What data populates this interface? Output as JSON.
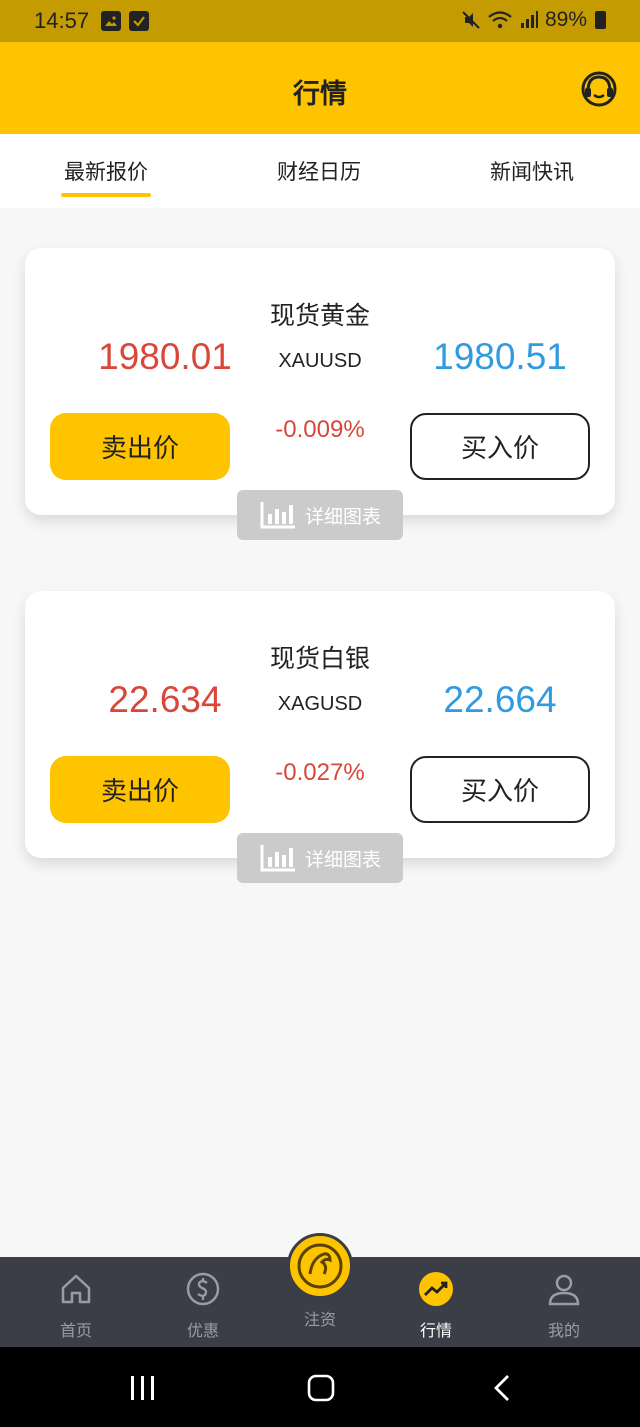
{
  "status_bar": {
    "time": "14:57",
    "battery": "89%"
  },
  "app_bar": {
    "title": "行情"
  },
  "tabs": [
    {
      "label": "最新报价",
      "active": true
    },
    {
      "label": "财经日历",
      "active": false
    },
    {
      "label": "新闻快讯",
      "active": false
    }
  ],
  "quotes": [
    {
      "name": "现货黄金",
      "symbol": "XAUUSD",
      "bid": "1980.01",
      "ask": "1980.51",
      "change": "-0.009%",
      "sell_label": "卖出价",
      "buy_label": "买入价",
      "chart_label": "详细图表"
    },
    {
      "name": "现货白银",
      "symbol": "XAGUSD",
      "bid": "22.634",
      "ask": "22.664",
      "change": "-0.027%",
      "sell_label": "卖出价",
      "buy_label": "买入价",
      "chart_label": "详细图表"
    }
  ],
  "bottom_nav": [
    {
      "label": "首页",
      "icon": "home-icon"
    },
    {
      "label": "优惠",
      "icon": "dollar-icon"
    },
    {
      "label": "注资",
      "icon": "deposit-logo-icon"
    },
    {
      "label": "行情",
      "icon": "trend-icon",
      "active": true
    },
    {
      "label": "我的",
      "icon": "user-icon"
    }
  ],
  "colors": {
    "accent": "#ffc400",
    "bid": "#d9463a",
    "ask": "#2f9be0",
    "nav_bg": "#3c3e47"
  }
}
